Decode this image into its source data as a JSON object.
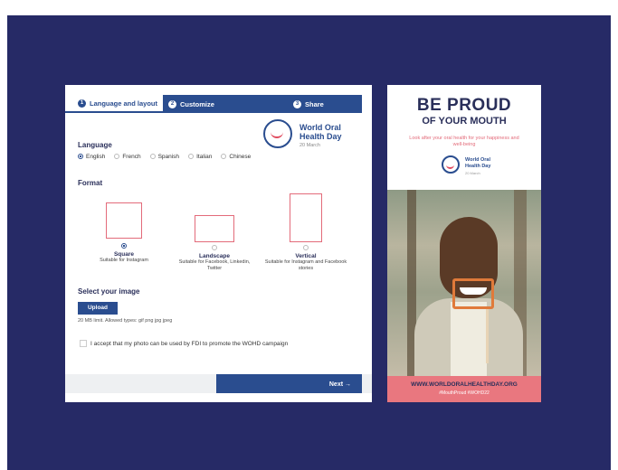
{
  "steps": {
    "step1": {
      "num": "1",
      "label": "Language and layout"
    },
    "step2": {
      "num": "2",
      "label": "Customize"
    },
    "step3": {
      "num": "3",
      "label": "Share"
    }
  },
  "brand": {
    "line1": "World Oral",
    "line2": "Health Day",
    "date": "20 March"
  },
  "language": {
    "heading": "Language",
    "options": [
      "English",
      "French",
      "Spanish",
      "Italian",
      "Chinese"
    ],
    "selected": "English"
  },
  "format": {
    "heading": "Format",
    "options": [
      {
        "title": "Square",
        "desc": "Suitable for Instagram"
      },
      {
        "title": "Landscape",
        "desc": "Suitable for Facebook, Linkedin, Twitter"
      },
      {
        "title": "Vertical",
        "desc": "Suitable for Instagram and Facebook stories"
      }
    ],
    "selected": "Square"
  },
  "image": {
    "heading": "Select your image",
    "upload_label": "Upload",
    "limit_text": "20 MB limit. Allowed types: gif png jpg jpeg"
  },
  "consent": {
    "label": "I accept that my photo can be used by FDI to promote the WOHD campaign"
  },
  "nav": {
    "next_label": "Next →"
  },
  "poster": {
    "title1": "BE PROUD",
    "title2": "OF YOUR MOUTH",
    "tagline": "Look after your oral health for your happiness and well-being",
    "logo_line1": "World Oral",
    "logo_line2": "Health Day",
    "logo_date": "20 March",
    "url": "WWW.WORLDORALHEALTHDAY.ORG",
    "hashtags": "#MouthProud #WOHD22"
  },
  "colors": {
    "navy": "#262a66",
    "blue": "#2a4d8f",
    "coral": "#e9777f"
  }
}
